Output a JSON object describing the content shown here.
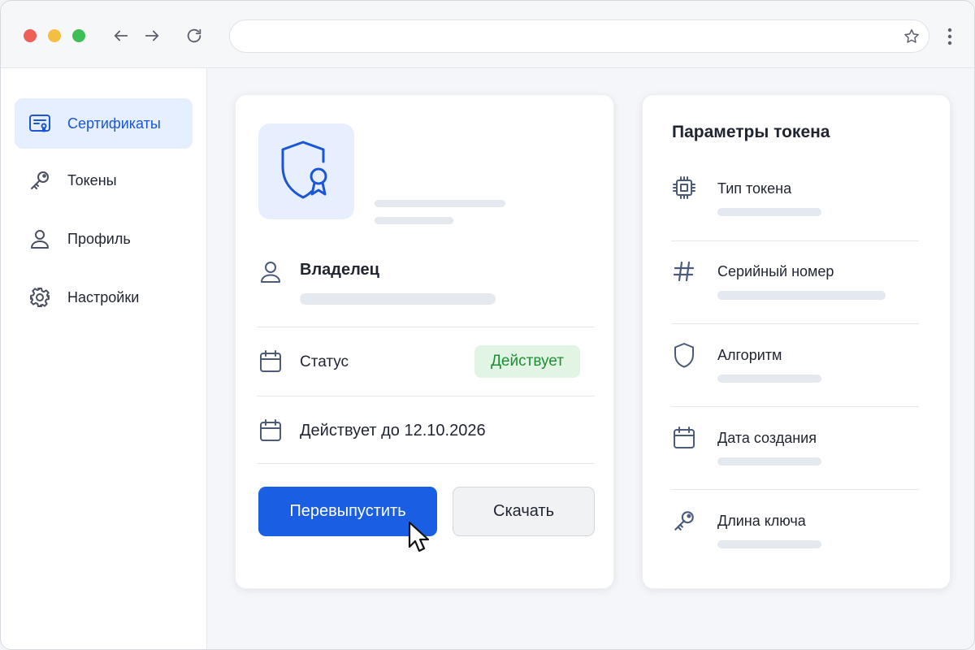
{
  "sidebar": {
    "items": [
      {
        "label": "Сертификаты",
        "icon": "certificate-card-icon",
        "active": true
      },
      {
        "label": "Токены",
        "icon": "key-icon"
      },
      {
        "label": "Профиль",
        "icon": "user-icon"
      },
      {
        "label": "Настройки",
        "icon": "gear-icon"
      }
    ]
  },
  "certificate": {
    "icon": "shield-award-icon",
    "owner_label": "Владелец",
    "status_label": "Статус",
    "status_value": "Действует",
    "valid_until_label": "Действует до 12.10.2026",
    "reissue_button": "Перевыпустить",
    "download_button": "Скачать"
  },
  "token_params": {
    "title": "Параметры токена",
    "items": [
      {
        "label": "Тип токена",
        "icon": "chip-icon"
      },
      {
        "label": "Серийный номер",
        "icon": "hash-icon"
      },
      {
        "label": "Алгоритм",
        "icon": "shield-icon"
      },
      {
        "label": "Дата создания",
        "icon": "calendar-icon"
      },
      {
        "label": "Длина ключа",
        "icon": "key-icon"
      }
    ]
  },
  "colors": {
    "accent": "#1a5fe3",
    "active_nav_bg": "#e6efff",
    "status_badge_bg": "#e2f5e5",
    "status_badge_text": "#1d8f35"
  }
}
